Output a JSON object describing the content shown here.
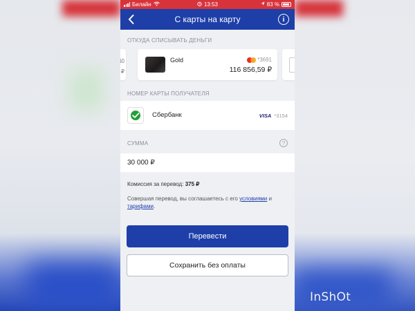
{
  "status_bar": {
    "carrier": "Билайн",
    "time": "13:53",
    "battery": "83 %"
  },
  "nav": {
    "title": "С карты на карту",
    "back_icon": "chevron-left-icon",
    "info_icon": "info-icon"
  },
  "source": {
    "section_label": "ОТКУДА СПИСЫВАТЬ ДЕНЬГИ",
    "prev_card_partial": {
      "number_fragment": "40",
      "balance_fragment": "₽"
    },
    "selected_card": {
      "name": "Gold",
      "number_mask": "*3691",
      "payment_system": "mastercard",
      "balance": "116 856,59 ₽"
    }
  },
  "recipient": {
    "section_label": "НОМЕР КАРТЫ ПОЛУЧАТЕЛЯ",
    "bank_name": "Сбербанк",
    "card_system": "VISA",
    "card_mask": "*3154"
  },
  "amount": {
    "section_label": "СУММА",
    "value": "30 000 ₽",
    "help_icon": "question-icon"
  },
  "fee": {
    "label": "Комиссия за перевод:",
    "value": "375 ₽"
  },
  "agreement": {
    "prefix": "Совершая перевод, вы соглашаетесь с его ",
    "link_terms": "условиями",
    "conjunction": " и",
    "link_tariffs": "тарифами",
    "suffix": "."
  },
  "actions": {
    "transfer_label": "Перевести",
    "save_label": "Сохранить без оплаты"
  },
  "watermark": "InShOt",
  "colors": {
    "primary": "#1e3fa8",
    "status_bar": "#d8333a",
    "background": "#eef0f4"
  }
}
